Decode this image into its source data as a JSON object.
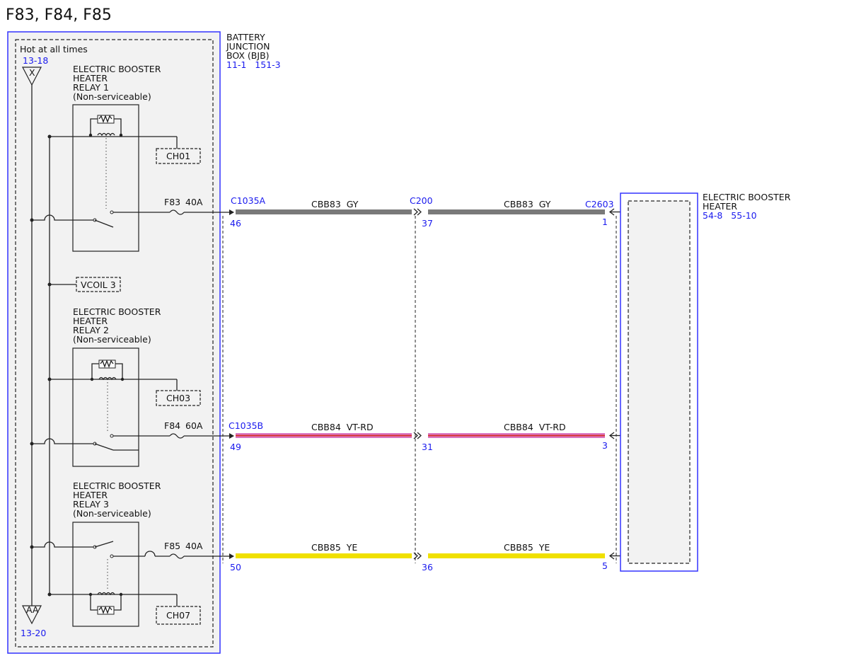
{
  "title": "F83, F84, F85",
  "bjb": {
    "label_lines": [
      "BATTERY",
      "JUNCTION",
      "BOX (BJB)"
    ],
    "refs": "11-1   151-3",
    "hot_label": "Hot at all times",
    "top_ref": "13-18",
    "top_tag": "X",
    "bottom_ref": "13-20",
    "bottom_tag": "AA",
    "vcoil": "VCOIL 3",
    "relays": [
      {
        "lines": [
          "ELECTRIC BOOSTER",
          "HEATER",
          "RELAY 1",
          "(Non-serviceable)"
        ],
        "ch": "CH01",
        "fuse": "F83",
        "amps": "40A"
      },
      {
        "lines": [
          "ELECTRIC BOOSTER",
          "HEATER",
          "RELAY 2",
          "(Non-serviceable)"
        ],
        "ch": "CH03",
        "fuse": "F84",
        "amps": "60A"
      },
      {
        "lines": [
          "ELECTRIC BOOSTER",
          "HEATER",
          "RELAY 3",
          "(Non-serviceable)"
        ],
        "ch": "CH07",
        "fuse": "F85",
        "amps": "40A"
      }
    ]
  },
  "heater": {
    "label_lines": [
      "ELECTRIC BOOSTER",
      "HEATER"
    ],
    "refs": "54-8   55-10"
  },
  "circuits": [
    {
      "left_connector": "C1035A",
      "mid_connector": "C200",
      "right_connector": "C2603",
      "wire": "CBB83  GY",
      "pin_left": "46",
      "pin_mid": "37",
      "pin_right": "1",
      "color": "#7a7a7a",
      "stripe": ""
    },
    {
      "left_connector": "C1035B",
      "mid_connector": "",
      "right_connector": "",
      "wire": "CBB84  VT-RD",
      "pin_left": "49",
      "pin_mid": "31",
      "pin_right": "3",
      "color": "#d977c4",
      "stripe": "#d8342f"
    },
    {
      "left_connector": "",
      "mid_connector": "",
      "right_connector": "",
      "wire": "CBB85  YE",
      "pin_left": "50",
      "pin_mid": "36",
      "pin_right": "5",
      "color": "#f0e000",
      "stripe": ""
    }
  ]
}
